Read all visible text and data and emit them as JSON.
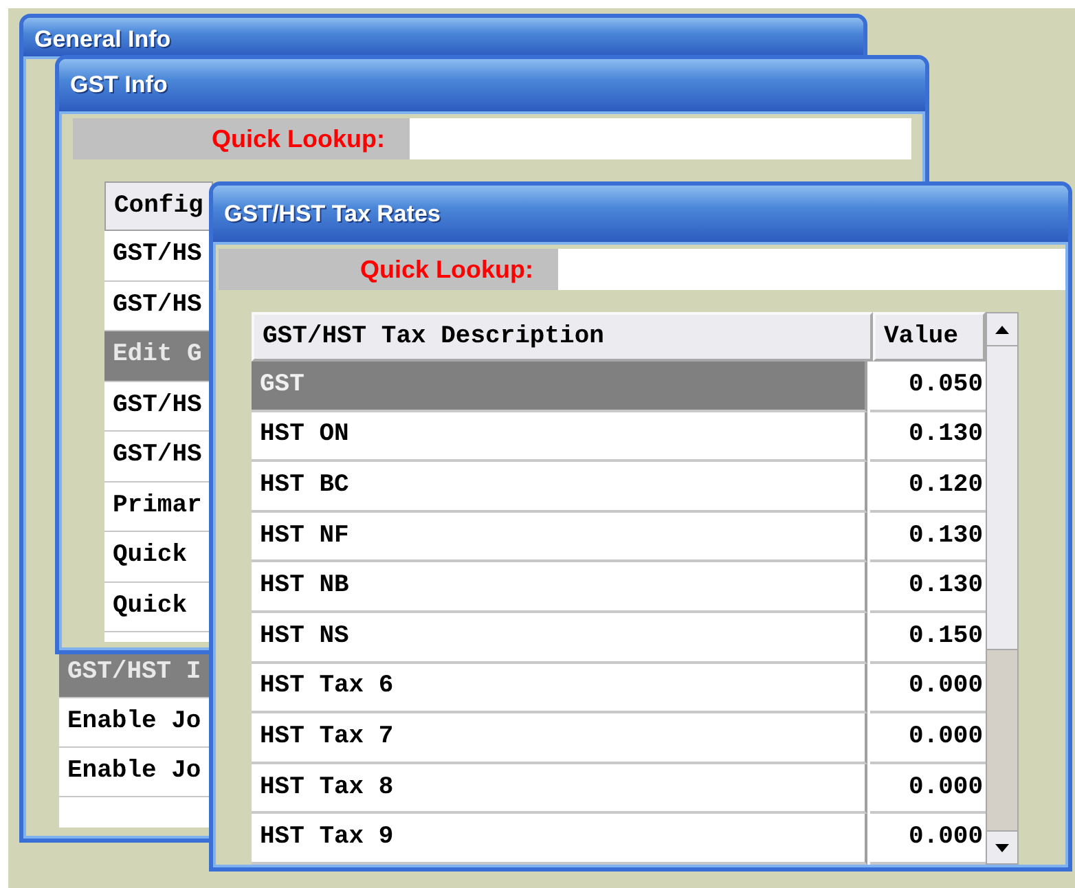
{
  "general_info": {
    "title": "General Info",
    "rows": [
      {
        "label": "GST/HST I",
        "selected": true
      },
      {
        "label": "Enable Jo",
        "selected": false
      },
      {
        "label": "Enable Jo",
        "selected": false
      }
    ]
  },
  "gst_info": {
    "title": "GST Info",
    "quick_lookup": {
      "label": "Quick Lookup:"
    },
    "table": {
      "column_1": "Config",
      "rows": [
        {
          "label": "GST/HS",
          "selected": false
        },
        {
          "label": "GST/HS",
          "selected": false
        },
        {
          "label": "Edit G",
          "selected": true
        },
        {
          "label": "GST/HS",
          "selected": false
        },
        {
          "label": "GST/HS",
          "selected": false
        },
        {
          "label": "Primar",
          "selected": false
        },
        {
          "label": "Quick",
          "selected": false
        },
        {
          "label": "Quick",
          "selected": false
        }
      ]
    }
  },
  "tax_rates": {
    "title": "GST/HST Tax Rates",
    "quick_lookup": {
      "label": "Quick Lookup:"
    },
    "table": {
      "columns": [
        "GST/HST Tax Description",
        "Value"
      ],
      "rows": [
        {
          "description": "GST",
          "value": "0.050",
          "selected": true
        },
        {
          "description": "HST ON",
          "value": "0.130",
          "selected": false
        },
        {
          "description": "HST BC",
          "value": "0.120",
          "selected": false
        },
        {
          "description": "HST NF",
          "value": "0.130",
          "selected": false
        },
        {
          "description": "HST NB",
          "value": "0.130",
          "selected": false
        },
        {
          "description": "HST NS",
          "value": "0.150",
          "selected": false
        },
        {
          "description": "HST Tax 6",
          "value": "0.000",
          "selected": false
        },
        {
          "description": "HST Tax 7",
          "value": "0.000",
          "selected": false
        },
        {
          "description": "HST Tax 8",
          "value": "0.000",
          "selected": false
        },
        {
          "description": "HST Tax 9",
          "value": "0.000",
          "selected": false
        }
      ]
    }
  }
}
